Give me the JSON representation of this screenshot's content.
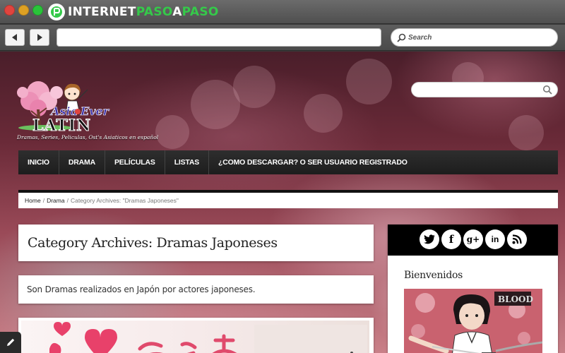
{
  "window": {
    "brand_prefix": "INTERNET",
    "brand_accent": "PASO",
    "brand_mid": "A",
    "brand_suffix": "PASO",
    "brand_color": "#35c94a"
  },
  "browser": {
    "back_icon": "triangle-left-icon",
    "forward_icon": "triangle-right-icon",
    "url_value": "",
    "search_placeholder": "Search"
  },
  "site": {
    "search_value": "",
    "logo_text_top": "Asia Ever",
    "logo_text_main": "LATIN",
    "tagline": "Dramas, Series, Peliculas, Ost's Asiaticos en español",
    "nav": [
      {
        "label": "INICIO"
      },
      {
        "label": "DRAMA"
      },
      {
        "label": "PELÍCULAS"
      },
      {
        "label": "LISTAS"
      },
      {
        "label": "¿COMO DESCARGAR? O SER USUARIO REGISTRADO"
      }
    ],
    "breadcrumb": {
      "home": "Home",
      "separator": "/",
      "section": "Drama",
      "current": "Category Archives: \"Dramas Japoneses\""
    },
    "category_title": "Category Archives: Dramas Japoneses",
    "category_description": "Son Dramas realizados en Japón por actores japoneses.",
    "sidebar": {
      "social_icons": [
        "twitter-icon",
        "facebook-icon",
        "google-plus-icon",
        "linkedin-icon",
        "rss-icon"
      ],
      "social_glyphs": [
        "t",
        "f",
        "g+",
        "in",
        "rss"
      ],
      "widget_title": "Bienvenidos"
    }
  }
}
